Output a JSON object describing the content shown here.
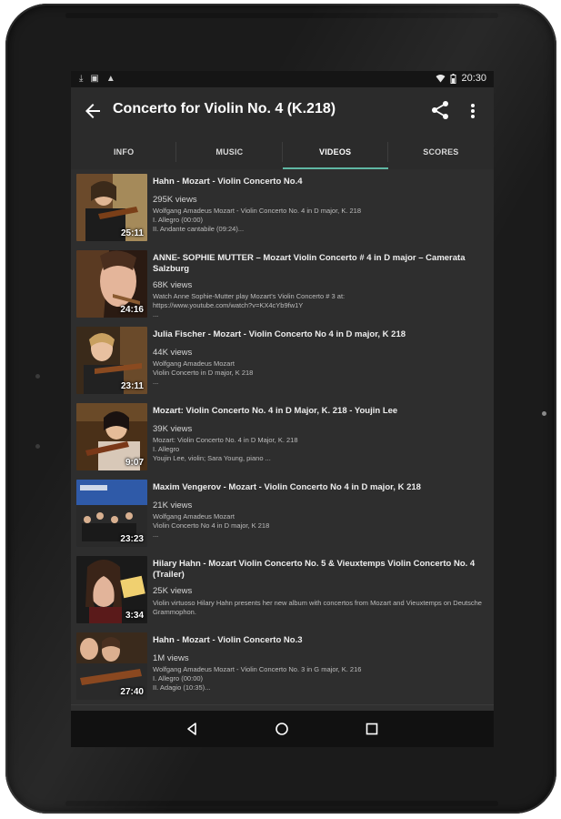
{
  "status": {
    "time": "20:30"
  },
  "appbar": {
    "title": "Concerto for Violin No. 4 (K.218)"
  },
  "tabs": [
    {
      "label": "INFO"
    },
    {
      "label": "MUSIC"
    },
    {
      "label": "VIDEOS"
    },
    {
      "label": "SCORES"
    }
  ],
  "active_tab": "VIDEOS",
  "colors": {
    "accent": "#5fb7a3",
    "background": "#303030",
    "appbar": "#2b2b2b"
  },
  "videos": [
    {
      "title": "Hahn - Mozart - Violin Concerto No.4",
      "views": "295K views",
      "description": "Wolfgang Amadeus Mozart - Violin Concerto No. 4 in D major, K. 218\nI. Allegro (00:00)\nII. Andante cantabile (09:24)...",
      "duration": "25:11"
    },
    {
      "title": "ANNE- SOPHIE MUTTER –  Mozart Violin Concerto # 4 in D major – Camerata Salzburg",
      "views": "68K views",
      "description": "Watch Anne Sophie-Mutter play Mozart's Violin Concerto # 3 at:\nhttps://www.youtube.com/watch?v=KX4cYb9fw1Y\n...",
      "duration": "24:16"
    },
    {
      "title": "Julia Fischer - Mozart - Violin Concerto No 4 in D major, K 218",
      "views": "44K views",
      "description": "Wolfgang Amadeus Mozart\nViolin Concerto in D major, K 218\n...",
      "duration": "23:11"
    },
    {
      "title": "Mozart: Violin Concerto No. 4 in D Major, K. 218 - Youjin Lee",
      "views": "39K views",
      "description": "Mozart: Violin Concerto No. 4 in D Major, K. 218\nI. Allegro\nYoujin Lee, violin; Sara Young, piano ...",
      "duration": "9:07"
    },
    {
      "title": "Maxim Vengerov - Mozart - Violin Concerto No 4 in D major, K 218",
      "views": "21K views",
      "description": "Wolfgang Amadeus Mozart\nViolin Concerto No 4 in D major, K 218\n...",
      "duration": "23:23"
    },
    {
      "title": "Hilary Hahn - Mozart Violin Concerto No. 5 & Vieuxtemps Violin Concerto No. 4 (Trailer)",
      "views": "25K views",
      "description": "Violin virtuoso Hilary Hahn presents her new album with concertos from Mozart and Vieuxtemps on Deutsche Grammophon.",
      "duration": "3:34"
    },
    {
      "title": "Hahn - Mozart - Violin Concerto No.3",
      "views": "1M views",
      "description": "Wolfgang Amadeus Mozart  - Violin Concerto No. 3 in G major, K. 216\nI. Allegro (00:00)\nII. Adagio (10:35)...",
      "duration": "27:40"
    }
  ]
}
